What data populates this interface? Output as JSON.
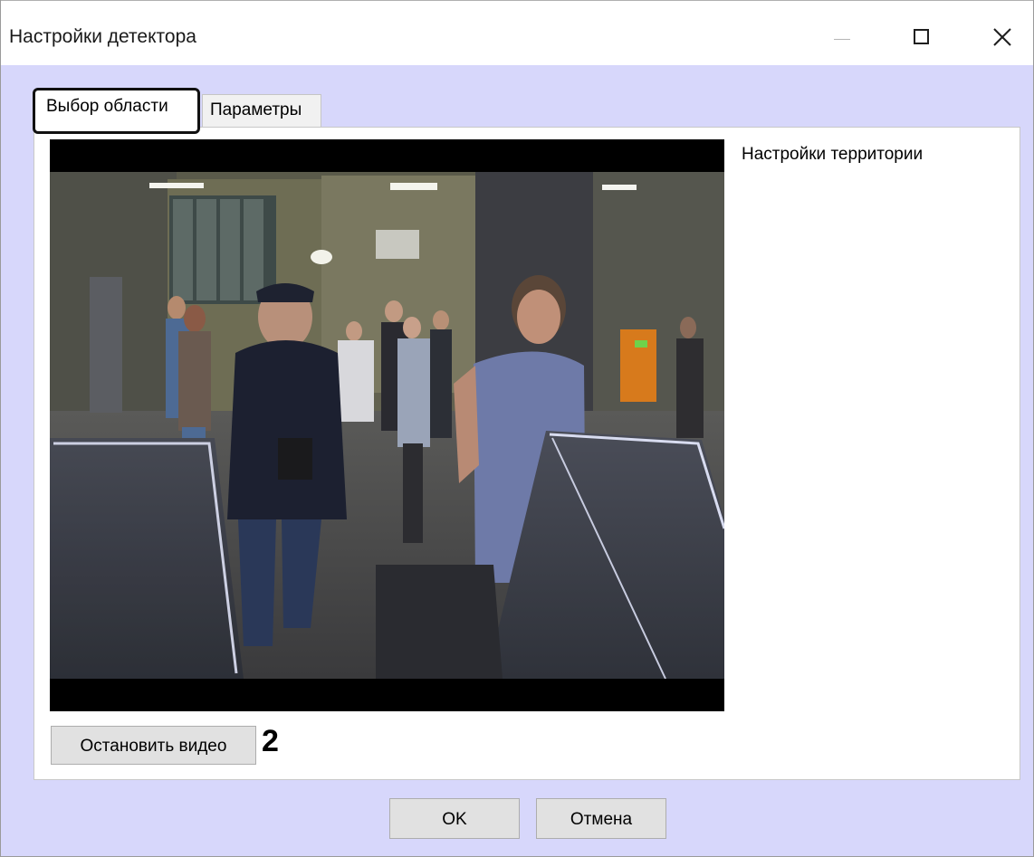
{
  "window": {
    "title": "Настройки детектора",
    "controls": {
      "minimize_icon": "minimize-icon",
      "maximize_icon": "maximize-icon",
      "close_icon": "close-icon"
    }
  },
  "tabs": [
    {
      "label": "Выбор области",
      "active": true
    },
    {
      "label": "Параметры",
      "active": false
    }
  ],
  "panel": {
    "territory_label": "Настройки территории",
    "video_preview_icon": "video-frame"
  },
  "buttons": {
    "stop_video": "Остановить видео",
    "ok": "OK",
    "cancel": "Отмена"
  },
  "annotations": {
    "callout_number": "2"
  },
  "colors": {
    "dialog_background": "#d7d7fb",
    "panel_background": "#ffffff",
    "button_face": "#e1e1e1",
    "highlight_border": "#111111"
  }
}
